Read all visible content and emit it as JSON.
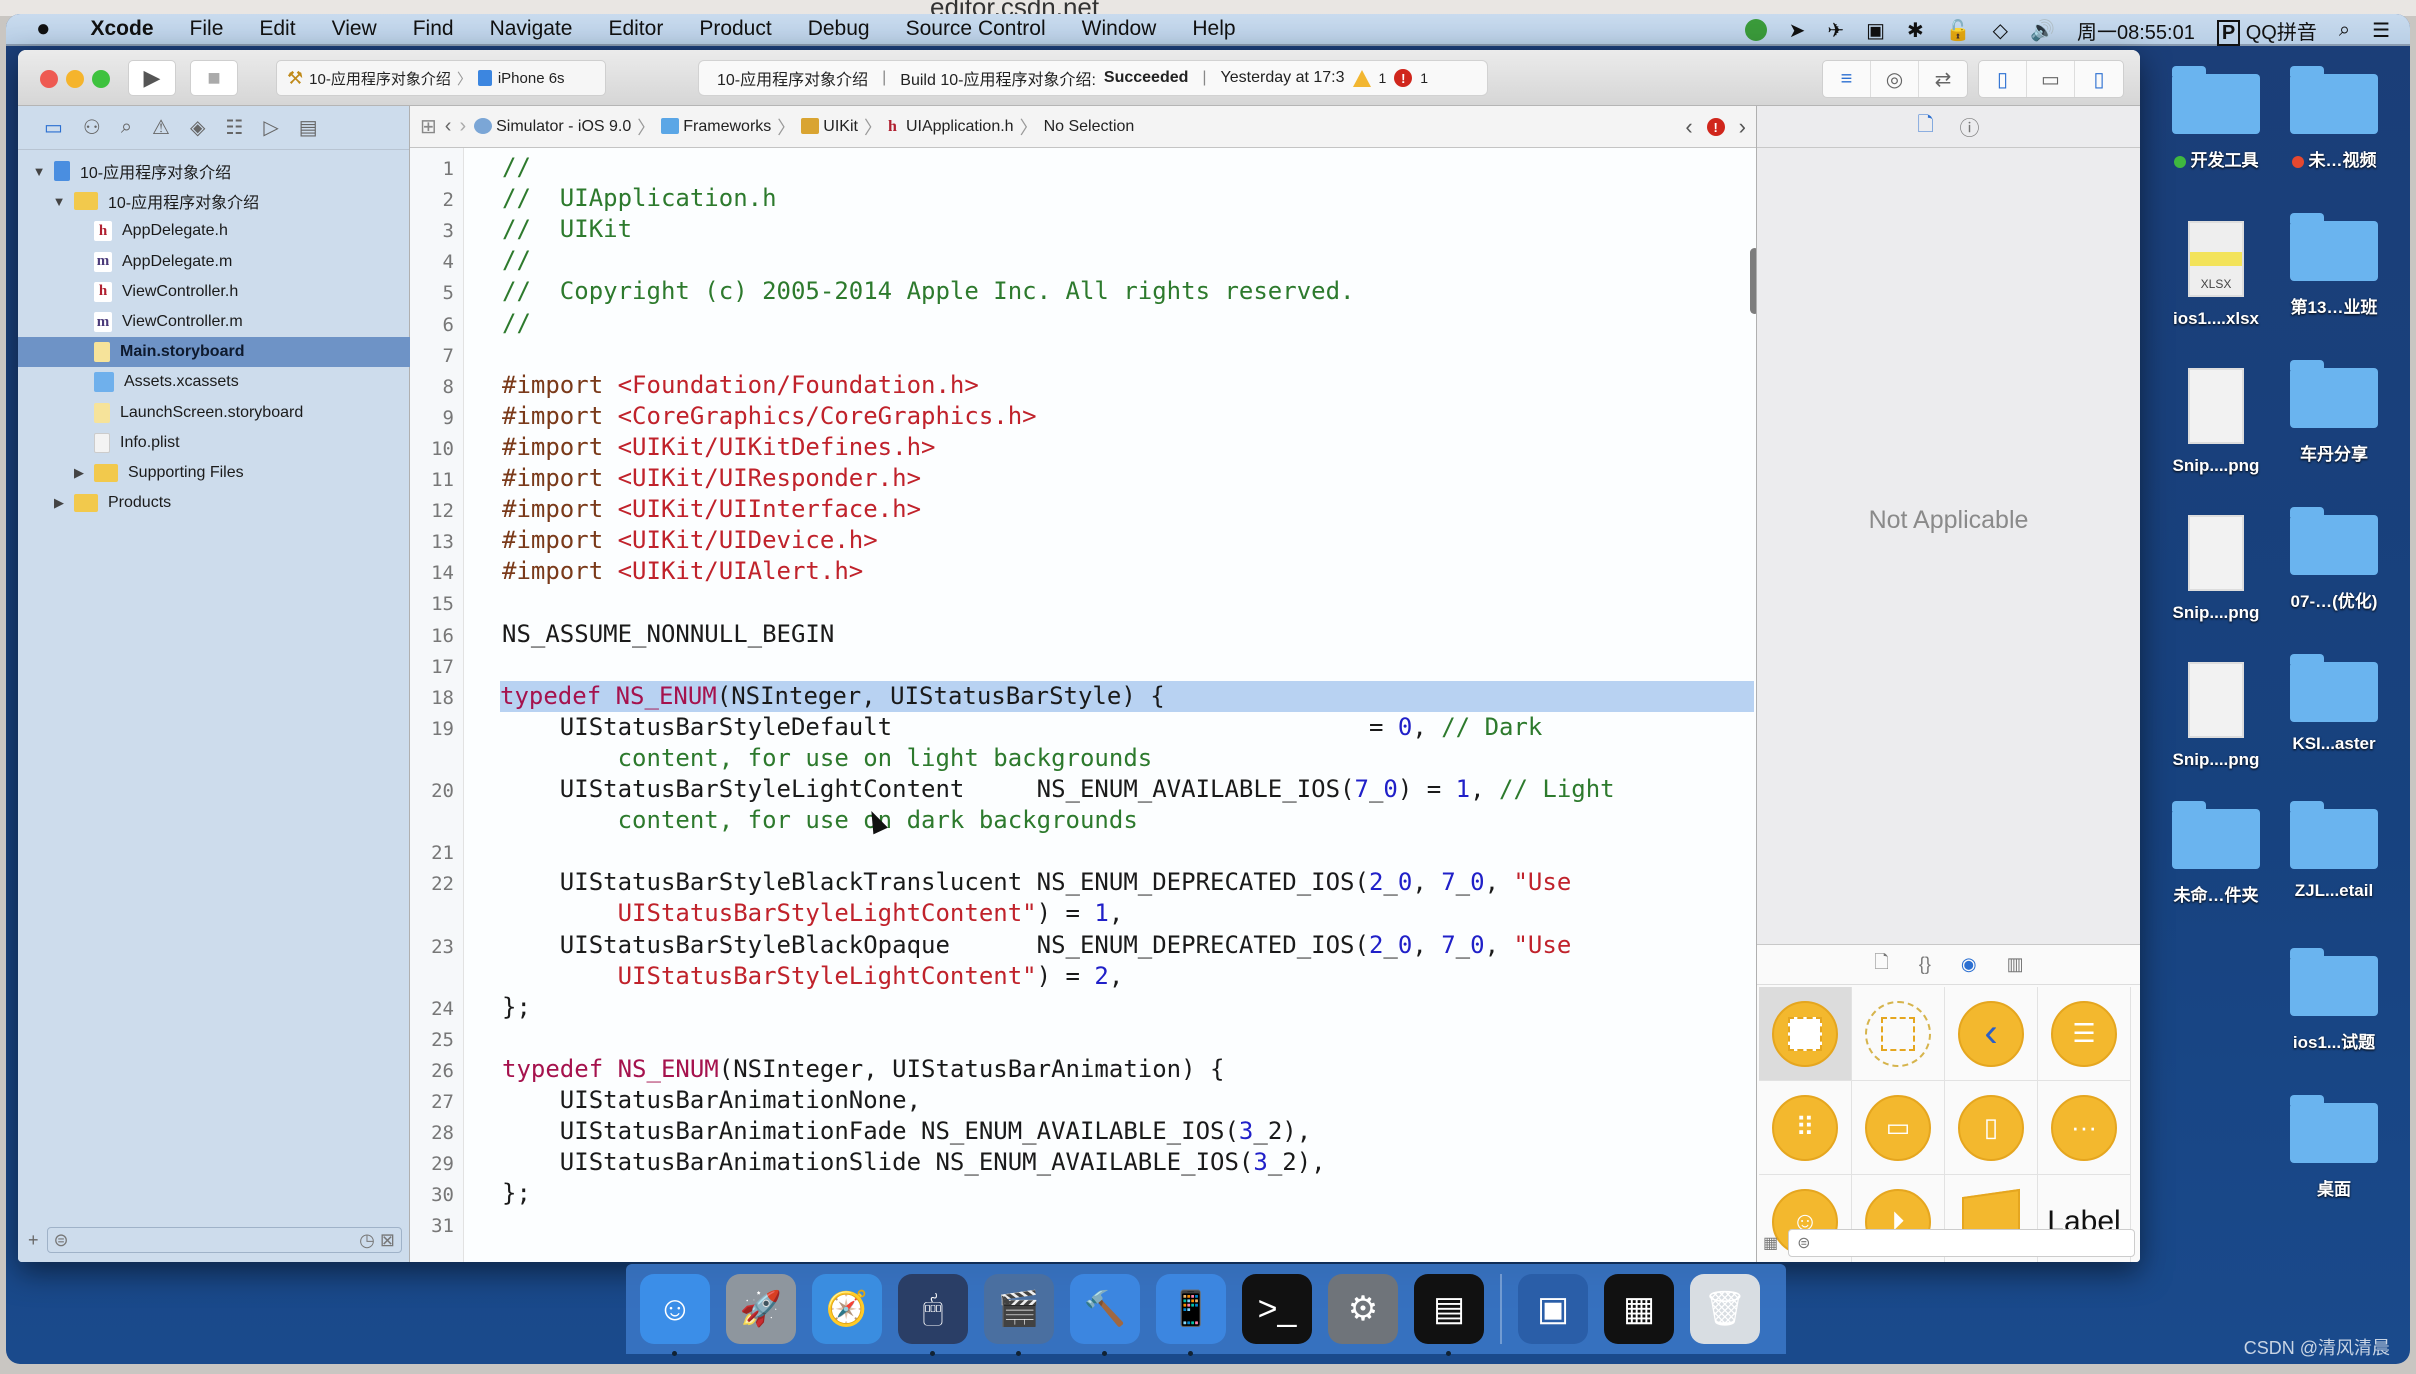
{
  "browser": {
    "url": "editor.csdn.net"
  },
  "menubar": {
    "apple_icon": "apple-icon",
    "app_name": "Xcode",
    "items": [
      "File",
      "Edit",
      "View",
      "Find",
      "Navigate",
      "Editor",
      "Product",
      "Debug",
      "Source Control",
      "Window",
      "Help"
    ],
    "clock": "周一08:55:01",
    "input_method": "QQ拼音",
    "status_icons": [
      "qq-icon",
      "location-icon",
      "airplane-icon",
      "camera-icon",
      "bluetooth-icon",
      "lock-icon",
      "wifi-icon",
      "volume-icon"
    ]
  },
  "toolbar": {
    "scheme_name": "10-应用程序对象介绍",
    "device": "iPhone 6s",
    "activity": {
      "project": "10-应用程序对象介绍",
      "build_prefix": "Build 10-应用程序对象介绍:",
      "build_status": "Succeeded",
      "time": "Yesterday at 17:3",
      "warnings": "1",
      "errors": "1"
    }
  },
  "navigator": {
    "tabs": [
      "folder-icon",
      "hierarchy-icon",
      "search-icon",
      "warning-icon",
      "test-icon",
      "debug-icon",
      "breakpoint-icon",
      "report-icon"
    ],
    "tree": [
      {
        "label": "10-应用程序对象介绍",
        "type": "project",
        "depth": 0,
        "disclosure": "open"
      },
      {
        "label": "10-应用程序对象介绍",
        "type": "folder",
        "depth": 1,
        "disclosure": "open"
      },
      {
        "label": "AppDelegate.h",
        "type": "h",
        "depth": 2
      },
      {
        "label": "AppDelegate.m",
        "type": "m",
        "depth": 2
      },
      {
        "label": "ViewController.h",
        "type": "h",
        "depth": 2
      },
      {
        "label": "ViewController.m",
        "type": "m",
        "depth": 2
      },
      {
        "label": "Main.storyboard",
        "type": "storyboard",
        "depth": 2,
        "selected": true
      },
      {
        "label": "Assets.xcassets",
        "type": "assets",
        "depth": 2
      },
      {
        "label": "LaunchScreen.storyboard",
        "type": "storyboard",
        "depth": 2
      },
      {
        "label": "Info.plist",
        "type": "plist",
        "depth": 2
      },
      {
        "label": "Supporting Files",
        "type": "folder",
        "depth": 2,
        "disclosure": "closed"
      },
      {
        "label": "Products",
        "type": "folder",
        "depth": 1,
        "disclosure": "closed"
      }
    ],
    "add_label": "+"
  },
  "jumpbar": {
    "crumbs": [
      "Simulator - iOS 9.0",
      "Frameworks",
      "UIKit",
      "UIApplication.h",
      "No Selection"
    ]
  },
  "editor": {
    "highlighted_line": 18,
    "lines": [
      {
        "n": "1",
        "segs": [
          [
            "c-com",
            "//"
          ]
        ]
      },
      {
        "n": "2",
        "segs": [
          [
            "c-com",
            "//  UIApplication.h"
          ]
        ]
      },
      {
        "n": "3",
        "segs": [
          [
            "c-com",
            "//  UIKit"
          ]
        ]
      },
      {
        "n": "4",
        "segs": [
          [
            "c-com",
            "//"
          ]
        ]
      },
      {
        "n": "5",
        "segs": [
          [
            "c-com",
            "//  Copyright (c) 2005-2014 Apple Inc. All rights reserved."
          ]
        ]
      },
      {
        "n": "6",
        "segs": [
          [
            "c-com",
            "//"
          ]
        ]
      },
      {
        "n": "7",
        "segs": []
      },
      {
        "n": "8",
        "segs": [
          [
            "c-mac",
            "#import "
          ],
          [
            "c-imp",
            "<Foundation/Foundation.h>"
          ]
        ]
      },
      {
        "n": "9",
        "segs": [
          [
            "c-mac",
            "#import "
          ],
          [
            "c-imp",
            "<CoreGraphics/CoreGraphics.h>"
          ]
        ]
      },
      {
        "n": "10",
        "segs": [
          [
            "c-mac",
            "#import "
          ],
          [
            "c-imp",
            "<UIKit/UIKitDefines.h>"
          ]
        ]
      },
      {
        "n": "11",
        "segs": [
          [
            "c-mac",
            "#import "
          ],
          [
            "c-imp",
            "<UIKit/UIResponder.h>"
          ]
        ]
      },
      {
        "n": "12",
        "segs": [
          [
            "c-mac",
            "#import "
          ],
          [
            "c-imp",
            "<UIKit/UIInterface.h>"
          ]
        ]
      },
      {
        "n": "13",
        "segs": [
          [
            "c-mac",
            "#import "
          ],
          [
            "c-imp",
            "<UIKit/UIDevice.h>"
          ]
        ]
      },
      {
        "n": "14",
        "segs": [
          [
            "c-mac",
            "#import "
          ],
          [
            "c-imp",
            "<UIKit/UIAlert.h>"
          ]
        ]
      },
      {
        "n": "15",
        "segs": []
      },
      {
        "n": "16",
        "segs": [
          [
            "",
            "NS_ASSUME_NONNULL_BEGIN"
          ]
        ]
      },
      {
        "n": "17",
        "segs": []
      },
      {
        "n": "18",
        "segs": [
          [
            "c-kw",
            "typedef "
          ],
          [
            "c-kw",
            "NS_ENUM"
          ],
          [
            "",
            "(NSInteger, UIStatusBarStyle) {"
          ]
        ]
      },
      {
        "n": "19",
        "segs": [
          [
            "",
            "    UIStatusBarStyleDefault                                 = "
          ],
          [
            "c-num",
            "0"
          ],
          [
            "",
            ", "
          ],
          [
            "c-com",
            "// Dark"
          ]
        ]
      },
      {
        "n": "",
        "segs": [
          [
            "c-com",
            "        content, for use on light backgrounds"
          ]
        ]
      },
      {
        "n": "20",
        "segs": [
          [
            "",
            "    UIStatusBarStyleLightContent     NS_ENUM_AVAILABLE_IOS("
          ],
          [
            "c-num",
            "7"
          ],
          [
            "",
            "_"
          ],
          [
            "c-num",
            "0"
          ],
          [
            "",
            ") = "
          ],
          [
            "c-num",
            "1"
          ],
          [
            "",
            ", "
          ],
          [
            "c-com",
            "// Light"
          ]
        ]
      },
      {
        "n": "",
        "segs": [
          [
            "c-com",
            "        content, for use on dark backgrounds"
          ]
        ]
      },
      {
        "n": "21",
        "segs": []
      },
      {
        "n": "22",
        "segs": [
          [
            "",
            "    UIStatusBarStyleBlackTranslucent NS_ENUM_DEPRECATED_IOS("
          ],
          [
            "c-num",
            "2"
          ],
          [
            "",
            "_"
          ],
          [
            "c-num",
            "0"
          ],
          [
            "",
            ", "
          ],
          [
            "c-num",
            "7"
          ],
          [
            "",
            "_"
          ],
          [
            "c-num",
            "0"
          ],
          [
            "",
            ", "
          ],
          [
            "c-str",
            "\"Use"
          ]
        ]
      },
      {
        "n": "",
        "segs": [
          [
            "c-str",
            "        UIStatusBarStyleLightContent\""
          ],
          [
            "",
            ") = "
          ],
          [
            "c-num",
            "1"
          ],
          [
            "",
            ","
          ]
        ]
      },
      {
        "n": "23",
        "segs": [
          [
            "",
            "    UIStatusBarStyleBlackOpaque      NS_ENUM_DEPRECATED_IOS("
          ],
          [
            "c-num",
            "2"
          ],
          [
            "",
            "_"
          ],
          [
            "c-num",
            "0"
          ],
          [
            "",
            ", "
          ],
          [
            "c-num",
            "7"
          ],
          [
            "",
            "_"
          ],
          [
            "c-num",
            "0"
          ],
          [
            "",
            ", "
          ],
          [
            "c-str",
            "\"Use"
          ]
        ]
      },
      {
        "n": "",
        "segs": [
          [
            "c-str",
            "        UIStatusBarStyleLightContent\""
          ],
          [
            "",
            ") = "
          ],
          [
            "c-num",
            "2"
          ],
          [
            "",
            ","
          ]
        ]
      },
      {
        "n": "24",
        "segs": [
          [
            "",
            "};"
          ]
        ]
      },
      {
        "n": "25",
        "segs": []
      },
      {
        "n": "26",
        "segs": [
          [
            "c-kw",
            "typedef "
          ],
          [
            "c-kw",
            "NS_ENUM"
          ],
          [
            "",
            "(NSInteger, UIStatusBarAnimation) {"
          ]
        ]
      },
      {
        "n": "27",
        "segs": [
          [
            "",
            "    UIStatusBarAnimationNone,"
          ]
        ]
      },
      {
        "n": "28",
        "segs": [
          [
            "",
            "    UIStatusBarAnimationFade NS_ENUM_AVAILABLE_IOS("
          ],
          [
            "c-num",
            "3"
          ],
          [
            "",
            "_2),"
          ]
        ]
      },
      {
        "n": "29",
        "segs": [
          [
            "",
            "    UIStatusBarAnimationSlide NS_ENUM_AVAILABLE_IOS("
          ],
          [
            "c-num",
            "3"
          ],
          [
            "",
            "_2),"
          ]
        ]
      },
      {
        "n": "30",
        "segs": [
          [
            "",
            "};"
          ]
        ]
      },
      {
        "n": "31",
        "segs": []
      }
    ]
  },
  "inspector": {
    "tabs": [
      "file-inspector-icon",
      "quick-help-icon"
    ],
    "placeholder": "Not Applicable",
    "library": {
      "tabs": [
        "file-template-icon",
        "code-snippet-icon",
        "object-library-icon",
        "media-library-icon"
      ],
      "items": [
        "view-controller",
        "storyboard-reference",
        "navigation-controller",
        "table-view-controller",
        "collection-view-controller",
        "tab-bar-controller",
        "split-view-controller",
        "page-view-controller",
        "glkit-view-controller",
        "av-player-view-controller",
        "object",
        "Label"
      ],
      "label_item_text": "Label"
    }
  },
  "desktop": {
    "items": [
      {
        "label": "开发工具",
        "kind": "folder",
        "tag": "#3fb83f"
      },
      {
        "label": "未…视频",
        "kind": "folder",
        "tag": "#e5482f"
      },
      {
        "label": "ios1....xlsx",
        "kind": "doc",
        "badge": "XLSX"
      },
      {
        "label": "第13…业班",
        "kind": "folder"
      },
      {
        "label": "Snip....png",
        "kind": "doc"
      },
      {
        "label": "车丹分享",
        "kind": "folder"
      },
      {
        "label": "Snip....png",
        "kind": "doc"
      },
      {
        "label": "07-…(优化)",
        "kind": "folder"
      },
      {
        "label": "Snip....png",
        "kind": "doc"
      },
      {
        "label": "KSI...aster",
        "kind": "folder"
      },
      {
        "label": "未命…件夹",
        "kind": "folder"
      },
      {
        "label": "ZJL...etail",
        "kind": "folder"
      },
      {
        "label": "",
        "kind": "empty"
      },
      {
        "label": "ios1...试题",
        "kind": "folder"
      },
      {
        "label": "",
        "kind": "empty"
      },
      {
        "label": "桌面",
        "kind": "folder"
      }
    ]
  },
  "dock": {
    "apps": [
      {
        "name": "finder",
        "glyph": "☺",
        "color": "#3b8ee8",
        "running": true
      },
      {
        "name": "launchpad",
        "glyph": "🚀",
        "color": "#8e969e",
        "running": false
      },
      {
        "name": "safari",
        "glyph": "🧭",
        "color": "#3a8de0",
        "running": false
      },
      {
        "name": "mouse-app",
        "glyph": "🖱",
        "color": "#2a3e66",
        "running": true
      },
      {
        "name": "imovie",
        "glyph": "🎬",
        "color": "#4a6fa0",
        "running": true
      },
      {
        "name": "xcode",
        "glyph": "🔨",
        "color": "#3c86e0",
        "running": true
      },
      {
        "name": "simulator",
        "glyph": "📱",
        "color": "#3c86e0",
        "running": true
      },
      {
        "name": "terminal",
        "glyph": ">_",
        "color": "#111111",
        "running": false
      },
      {
        "name": "system-preferences",
        "glyph": "⚙",
        "color": "#6f747a",
        "running": false
      },
      {
        "name": "console",
        "glyph": "▤",
        "color": "#111111",
        "running": true
      },
      {
        "name": "screen-sharing",
        "glyph": "▣",
        "color": "#2a5ea8",
        "running": false
      },
      {
        "name": "calculator",
        "glyph": "▦",
        "color": "#111111",
        "running": false
      },
      {
        "name": "trash",
        "glyph": "🗑",
        "color": "#d8dde2",
        "running": false
      }
    ]
  },
  "watermark": "CSDN @清风清晨"
}
